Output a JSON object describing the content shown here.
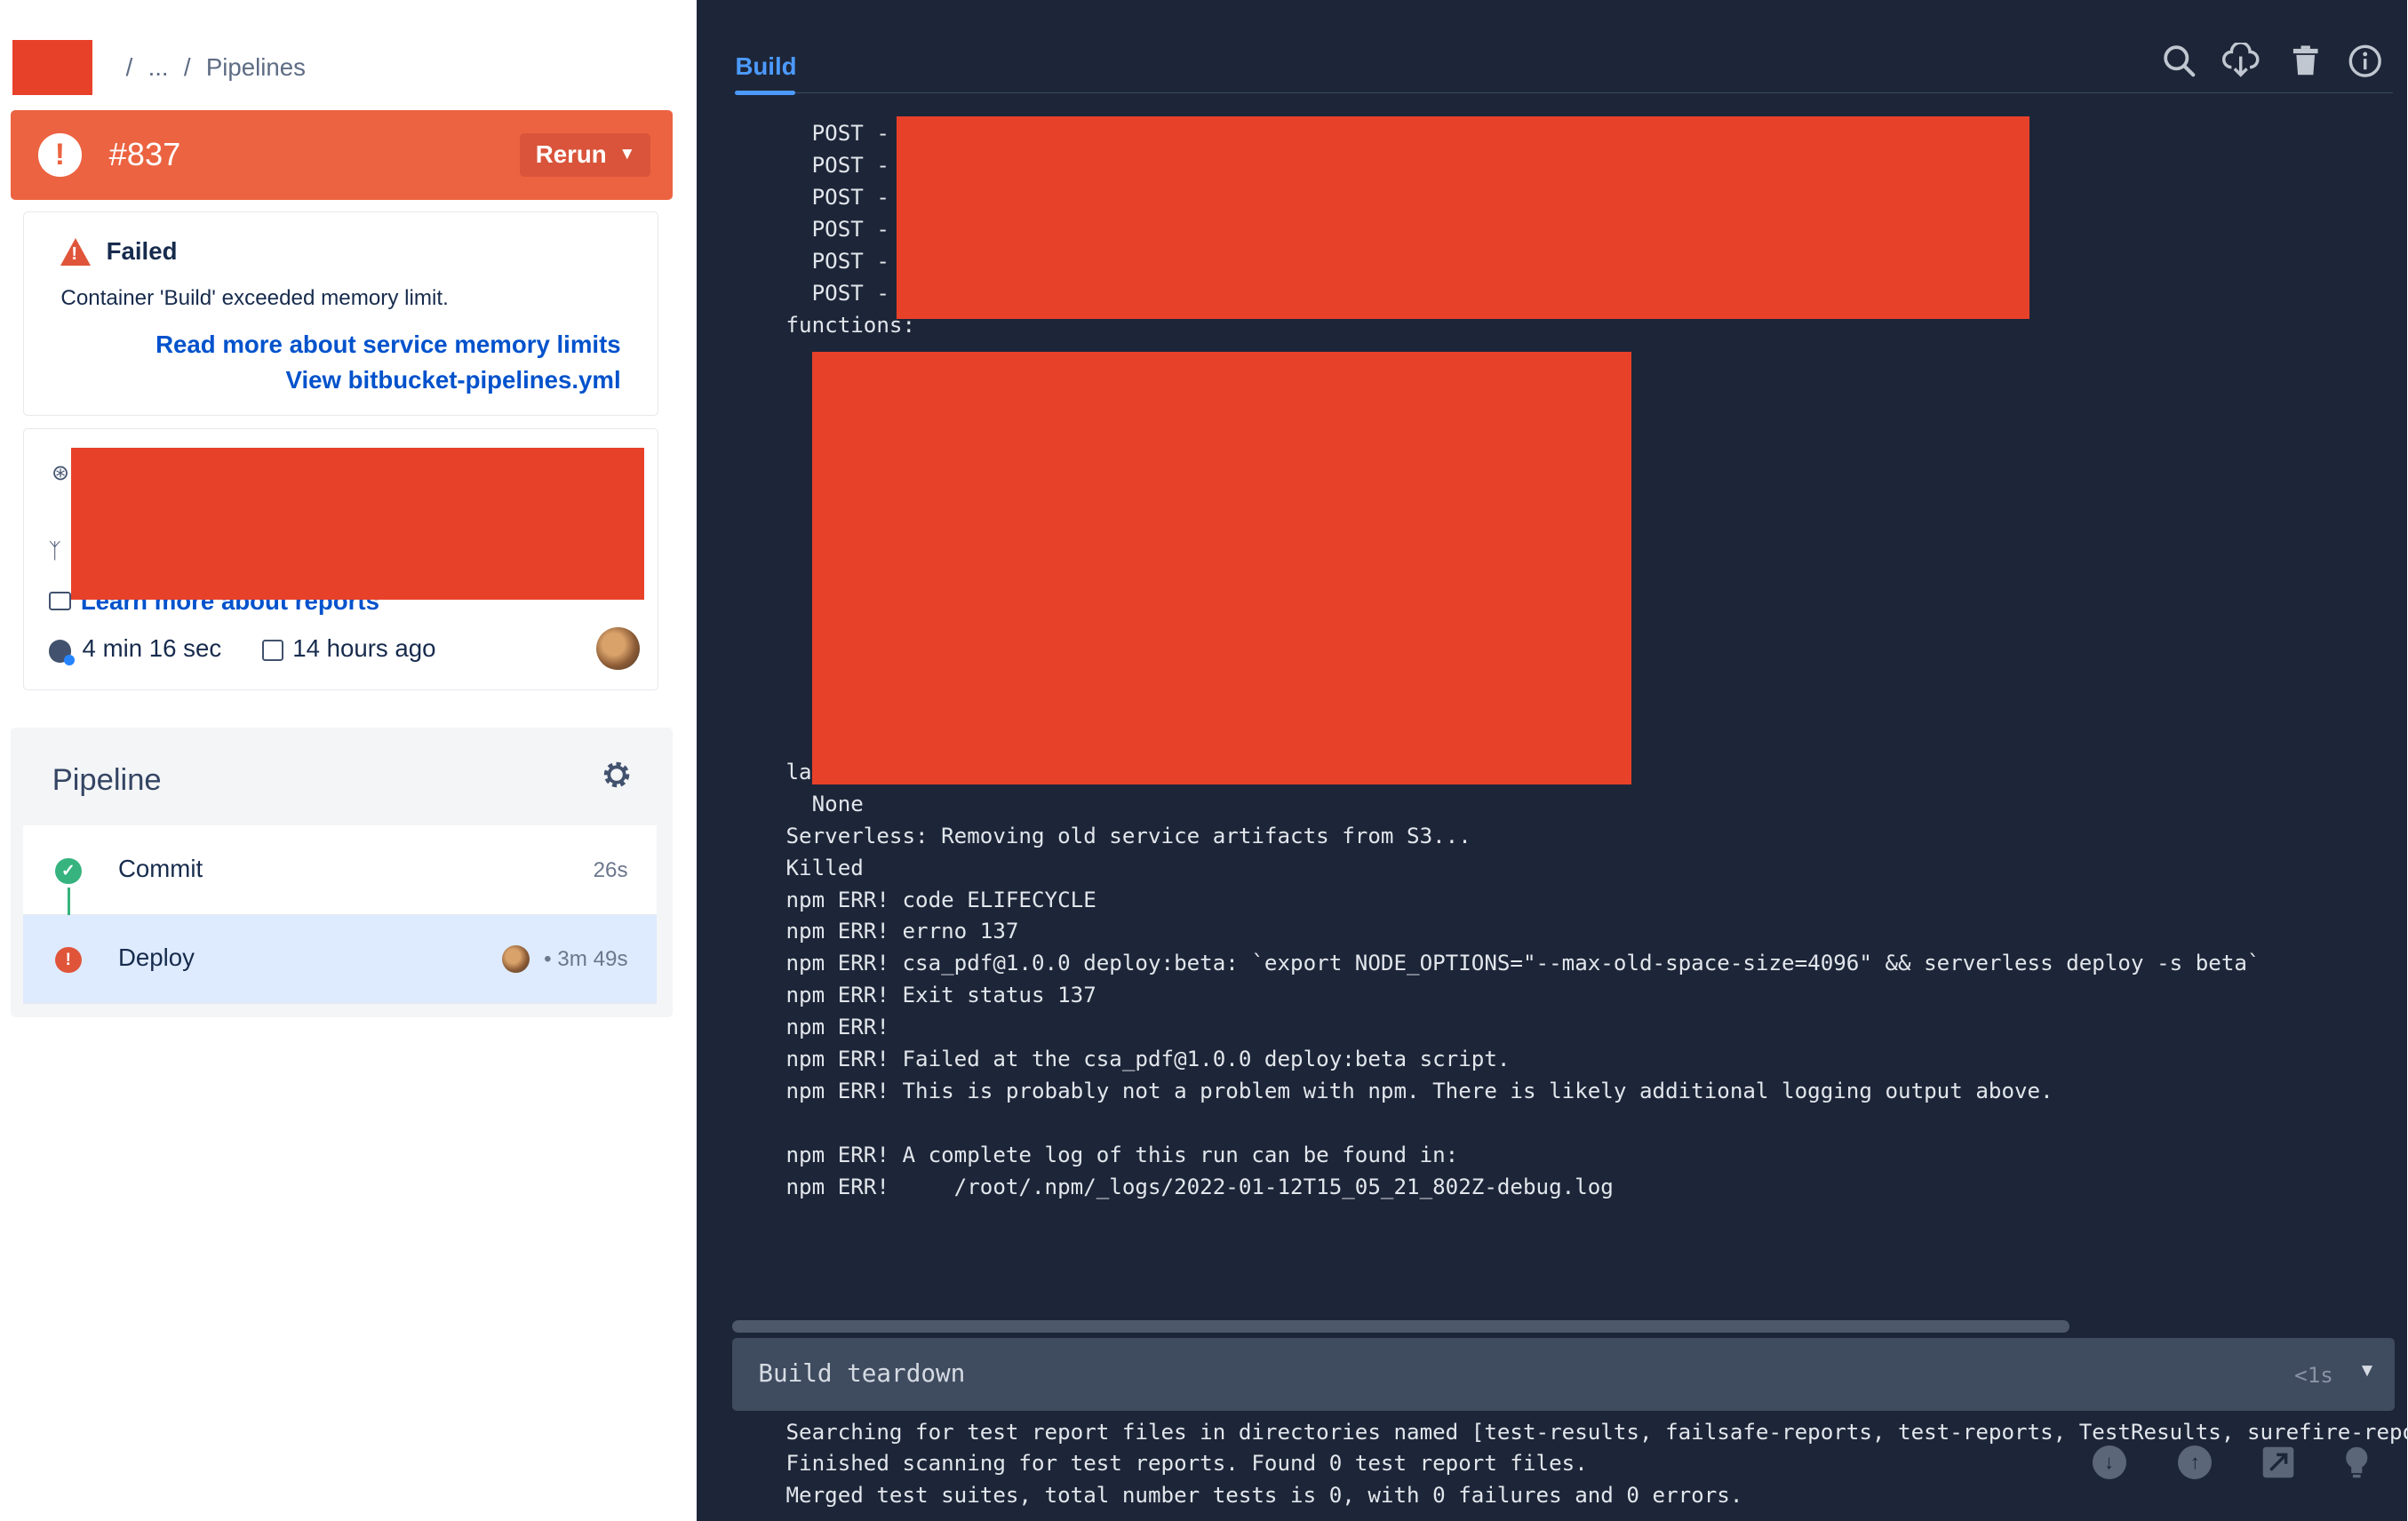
{
  "breadcrumb": {
    "ellipsis": "...",
    "separator": "/",
    "current": "Pipelines"
  },
  "build": {
    "number": "#837",
    "rerun_label": "Rerun",
    "fail_icon": "!"
  },
  "status": {
    "title": "Failed",
    "message": "Container 'Build' exceeded memory limit.",
    "link_memory": "Read more about service memory limits",
    "link_yml": "View bitbucket-pipelines.yml"
  },
  "meta": {
    "reports_link": "Learn more about reports",
    "duration": "4 min 16 sec",
    "started": "14 hours ago",
    "icons": {
      "commit": "commit-icon",
      "branch": "branch-icon",
      "reports": "reports-icon",
      "duration": "clock-icon",
      "date": "calendar-icon"
    }
  },
  "pipeline": {
    "title": "Pipeline",
    "steps": [
      {
        "name": "Commit",
        "time": "26s",
        "status": "success"
      },
      {
        "name": "Deploy",
        "time": "• 3m 49s",
        "status": "failed"
      }
    ]
  },
  "log_panel": {
    "tab": "Build",
    "tools": [
      "search-icon",
      "download-icon",
      "delete-icon",
      "info-icon"
    ],
    "lines": [
      "  POST -",
      "  POST -",
      "  POST -",
      "  POST -",
      "  POST -",
      "  POST -",
      "functions:",
      "",
      "",
      "",
      "",
      "",
      "",
      "",
      "",
      "",
      "",
      "",
      "",
      "",
      "layers:",
      "  None",
      "Serverless: Removing old service artifacts from S3...",
      "Killed",
      "npm ERR! code ELIFECYCLE",
      "npm ERR! errno 137",
      "npm ERR! csa_pdf@1.0.0 deploy:beta: `export NODE_OPTIONS=\"--max-old-space-size=4096\" && serverless deploy -s beta`",
      "npm ERR! Exit status 137",
      "npm ERR!",
      "npm ERR! Failed at the csa_pdf@1.0.0 deploy:beta script.",
      "npm ERR! This is probably not a problem with npm. There is likely additional logging output above.",
      "",
      "npm ERR! A complete log of this run can be found in:",
      "npm ERR!     /root/.npm/_logs/2022-01-12T15_05_21_802Z-debug.log"
    ],
    "teardown": {
      "label": "Build teardown",
      "time": "<1s",
      "lines": [
        "Searching for test report files in directories named [test-results, failsafe-reports, test-reports, TestResults, surefire-reports",
        "Finished scanning for test reports. Found 0 test report files.",
        "Merged test suites, total number tests is 0, with 0 failures and 0 errors."
      ]
    },
    "footer_tools": [
      "scroll-down-icon",
      "scroll-up-icon",
      "expand-icon",
      "lightbulb-icon"
    ]
  },
  "colors": {
    "accent_fail": "#ec6341",
    "link": "#0052cc",
    "log_bg": "#1d2638",
    "success": "#36b37e",
    "redaction": "#e8412a"
  }
}
